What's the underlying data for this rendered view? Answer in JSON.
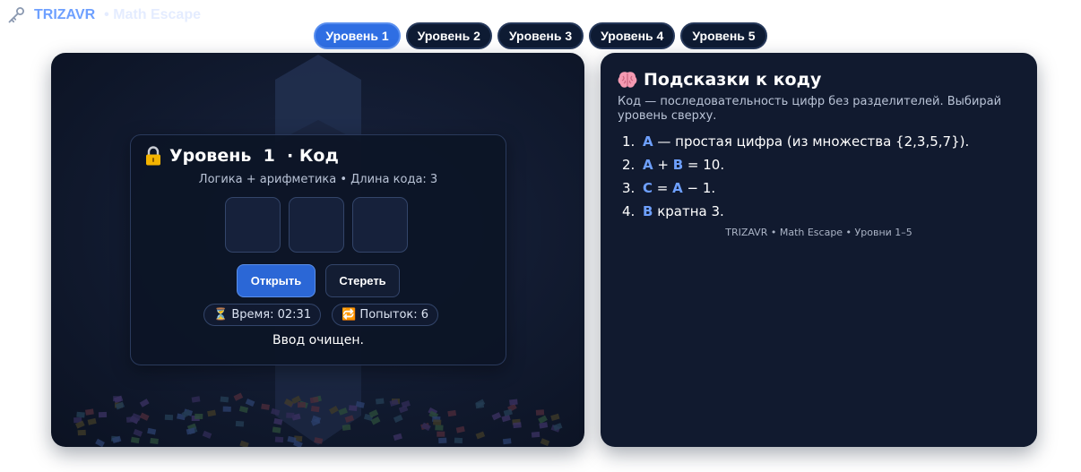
{
  "brand": {
    "name": "TRIZAVR",
    "subtitle": "• Math Escape",
    "icon": "key-icon"
  },
  "levels": [
    {
      "label": "Уровень 1",
      "active": true
    },
    {
      "label": "Уровень 2",
      "active": false
    },
    {
      "label": "Уровень 3",
      "active": false
    },
    {
      "label": "Уровень 4",
      "active": false
    },
    {
      "label": "Уровень 5",
      "active": false
    }
  ],
  "card": {
    "title": "Уровень  1  · Код",
    "subtitle": "Логика + арифметика • Длина кода: 3",
    "code_length": 3,
    "buttons": {
      "open": "Открыть",
      "clear": "Стереть"
    },
    "timer": "⏳ Время: 02:31",
    "attempts": "🔁 Попыток: 6",
    "message": "Ввод очищен."
  },
  "hints": {
    "title": "Подсказки к коду",
    "description": "Код — последовательность цифр без разделителей. Выбирай уровень сверху.",
    "items": [
      {
        "num": "1.",
        "v1": "A",
        "t1": " — простая цифра (из множества {2,3,5,7}).",
        "v2": "",
        "t2": ""
      },
      {
        "num": "2.",
        "v1": "A",
        "t1": " + ",
        "v2": "B",
        "t2": " = 10."
      },
      {
        "num": "3.",
        "v1": "C",
        "t1": " = ",
        "v2": "A",
        "t2": " − 1."
      },
      {
        "num": "4.",
        "v1": "B",
        "t1": " кратна 3.",
        "v2": "",
        "t2": ""
      }
    ],
    "footer": "TRIZAVR • Math Escape • Уровни 1–5"
  },
  "colors": {
    "accent": "#2f6ee3",
    "highlight": "#6ea0ff",
    "panel": "#111a2f",
    "card": "#0c1426"
  }
}
